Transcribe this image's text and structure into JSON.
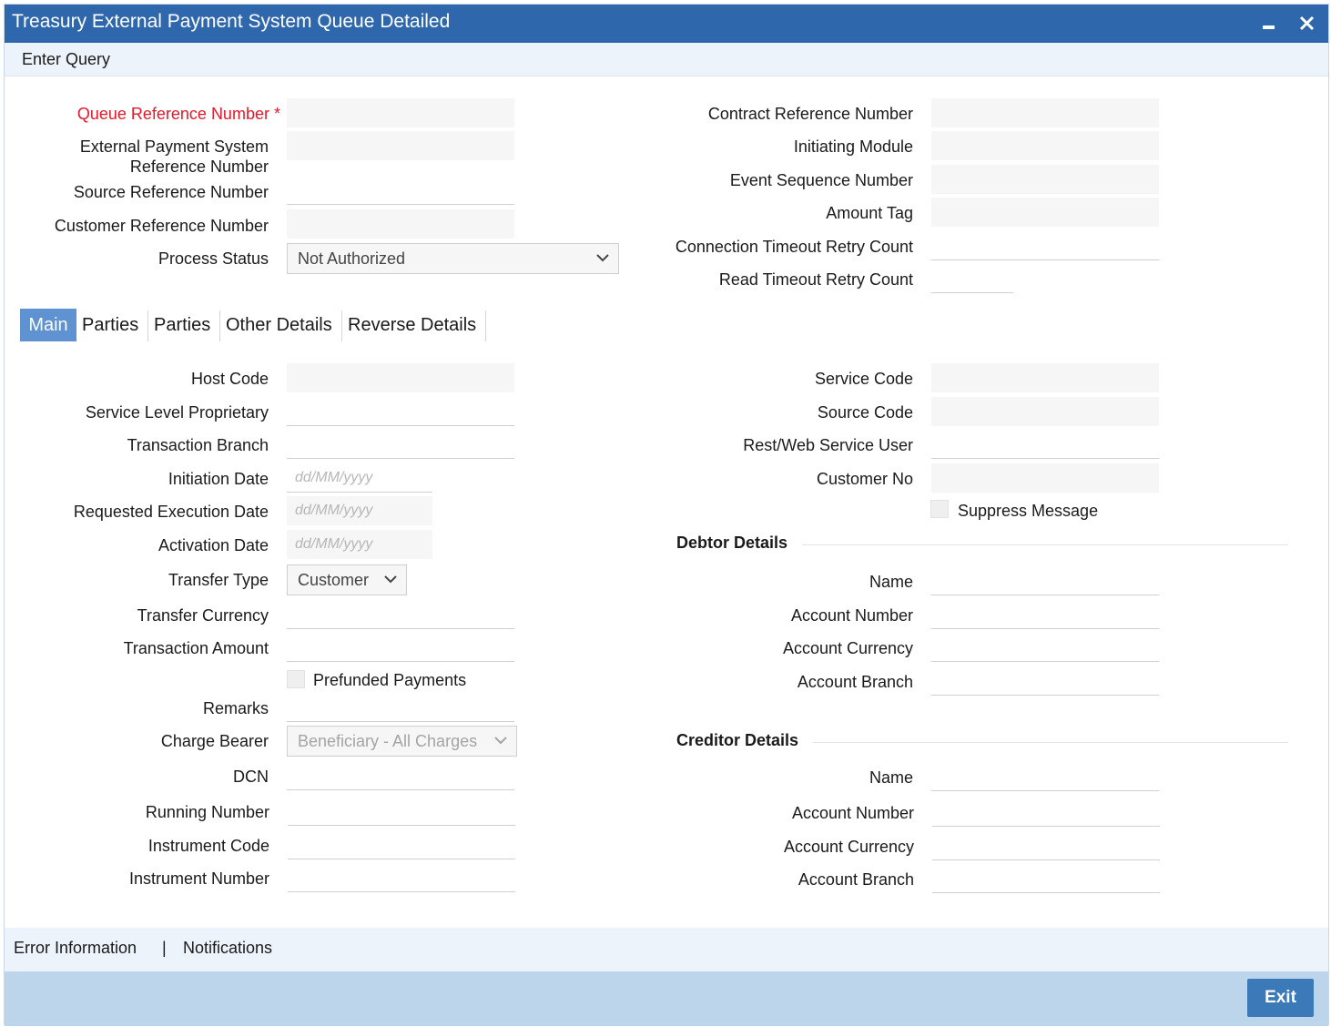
{
  "window": {
    "title": "Treasury External Payment System Queue Detailed",
    "minimize_icon": "minimize-icon",
    "close_icon": "close-icon"
  },
  "toolbar": {
    "enter_query": "Enter Query"
  },
  "header_left": {
    "queue_ref": {
      "label": "Queue Reference Number",
      "required_mark": "*"
    },
    "ext_ref_line1": "External Payment System",
    "ext_ref_line2": "Reference Number",
    "source_ref": "Source Reference Number",
    "customer_ref": "Customer Reference Number",
    "process_status": {
      "label": "Process Status",
      "value": "Not Authorized"
    }
  },
  "header_right": {
    "contract_ref": "Contract Reference Number",
    "initiating_module": "Initiating Module",
    "event_seq": "Event Sequence Number",
    "amount_tag": "Amount Tag",
    "conn_timeout": "Connection Timeout Retry Count",
    "read_timeout": "Read Timeout Retry Count"
  },
  "tabs": [
    "Main",
    "Parties",
    "Parties",
    "Other Details",
    "Reverse Details"
  ],
  "main_left": {
    "host_code": "Host Code",
    "service_level": "Service Level Proprietary",
    "transaction_branch": "Transaction Branch",
    "initiation_date": "Initiation Date",
    "requested_exec_date": "Requested Execution Date",
    "activation_date": "Activation Date",
    "date_placeholder": "dd/MM/yyyy",
    "transfer_type": {
      "label": "Transfer Type",
      "value": "Customer"
    },
    "transfer_currency": "Transfer Currency",
    "transaction_amount": "Transaction Amount",
    "prefunded": "Prefunded Payments",
    "remarks": "Remarks",
    "charge_bearer": {
      "label": "Charge Bearer",
      "value": "Beneficiary - All Charges"
    },
    "dcn": "DCN",
    "running_number": "Running Number",
    "instrument_code": "Instrument Code",
    "instrument_number": "Instrument Number"
  },
  "main_right": {
    "service_code": "Service Code",
    "source_code": "Source Code",
    "rest_user": "Rest/Web Service User",
    "customer_no": "Customer No",
    "suppress_message": "Suppress Message",
    "debtor": {
      "title": "Debtor Details",
      "name": "Name",
      "account_number": "Account Number",
      "account_currency": "Account Currency",
      "account_branch": "Account Branch"
    },
    "creditor": {
      "title": "Creditor Details",
      "name": "Name",
      "account_number": "Account Number",
      "account_currency": "Account Currency",
      "account_branch": "Account Branch"
    }
  },
  "footer": {
    "error_info": "Error Information",
    "separator": "|",
    "notifications": "Notifications",
    "exit": "Exit"
  }
}
